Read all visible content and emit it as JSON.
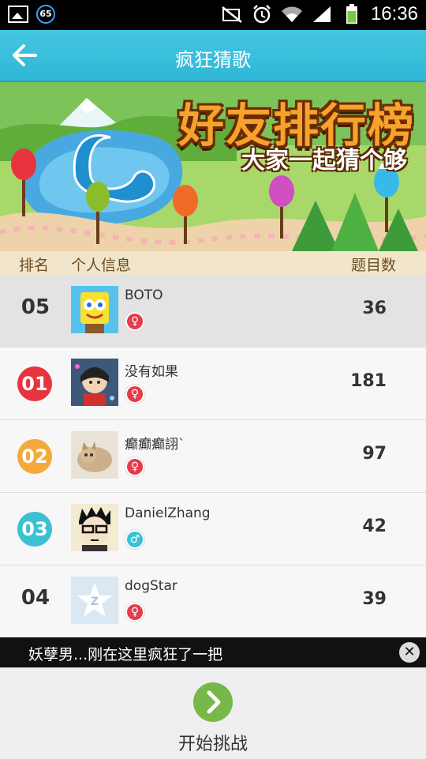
{
  "status_bar": {
    "notification_badge": "65",
    "time": "16:36"
  },
  "header": {
    "title": "疯狂猜歌"
  },
  "banner": {
    "title": "好友排行榜",
    "subtitle": "大家一起猜个够"
  },
  "table_header": {
    "rank": "排名",
    "info": "个人信息",
    "count": "题目数"
  },
  "rows": [
    {
      "rank": "05",
      "name": "BOTO",
      "gender": "female",
      "gender_symbol": "♀",
      "count": "36",
      "highlight": true
    },
    {
      "rank": "01",
      "name": "没有如果",
      "gender": "female",
      "gender_symbol": "♀",
      "count": "181",
      "rank_color": "#e8343f"
    },
    {
      "rank": "02",
      "name": "癫癫癫詡`",
      "gender": "female",
      "gender_symbol": "♀",
      "count": "97",
      "rank_color": "#f5a93a"
    },
    {
      "rank": "03",
      "name": "DanielZhang",
      "gender": "male",
      "gender_symbol": "♂",
      "count": "42",
      "rank_color": "#3cc0d3"
    },
    {
      "rank": "04",
      "name": "dogStar",
      "gender": "female",
      "gender_symbol": "♀",
      "count": "39"
    }
  ],
  "ticker": {
    "text": "妖孽男...刚在这里疯狂了一把"
  },
  "bottom": {
    "start_label": "开始挑战"
  },
  "colors": {
    "header": "#3dbfdc",
    "female": "#e63c4a",
    "male": "#3cc0d3",
    "start_button": "#76b84a"
  }
}
